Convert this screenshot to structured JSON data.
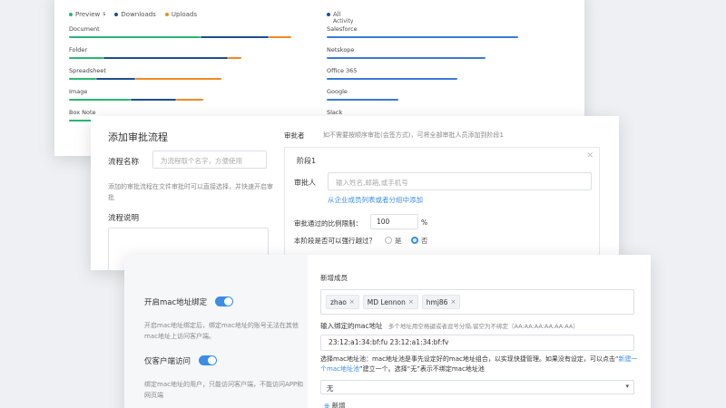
{
  "stats": {
    "legend": {
      "preview": "Preview",
      "preview_sub": "s",
      "downloads": "Downloads",
      "uploads": "Uploads"
    },
    "colors": {
      "preview": "#2bb673",
      "downloads": "#1f4e8c",
      "uploads": "#f08a24",
      "all": "#3a7bd5"
    },
    "left_rows": [
      {
        "label": "Document",
        "preview": 0.58,
        "downloads": 0.3,
        "uploads": 0.1
      },
      {
        "label": "Folder",
        "preview": 0.15,
        "downloads": 0.55,
        "uploads": 0.06
      },
      {
        "label": "Spreadsheet",
        "preview": 0.12,
        "downloads": 0.17,
        "uploads": 0.38
      },
      {
        "label": "Image",
        "preview": 0.27,
        "downloads": 0.2,
        "uploads": 0.12
      },
      {
        "label": "Box Note",
        "preview": 0.16,
        "downloads": 0.0,
        "uploads": 0.0
      }
    ],
    "right_legend": {
      "all": "All",
      "all_sub": "Activity"
    },
    "right_rows": [
      {
        "label": "Salesforce",
        "value": 0.88
      },
      {
        "label": "Netskope",
        "value": 0.73
      },
      {
        "label": "Office 365",
        "value": 0.6
      },
      {
        "label": "Google",
        "value": 0.33
      },
      {
        "label": "Slack",
        "value": 0.0
      }
    ]
  },
  "flow": {
    "title": "添加审批流程",
    "name_label": "流程名称",
    "name_placeholder": "为流程取个名字，方便使用",
    "name_hint": "添加的审批流程在文件审批时可以直接选择，并快速开启审批",
    "desc_label": "流程说明",
    "approver_label": "审批者",
    "approver_hint": "如不需要按顺序审批(会签方式)，可将全部审批人员添加到阶段1",
    "stage_title": "阶段1",
    "stage_approver_label": "审批人",
    "stage_approver_placeholder": "输入姓名,邮箱,或手机号",
    "add_from_group": "从企业成员列表或者分组中添加",
    "ratio_label": "审批通过的比例限制：",
    "ratio_value": "100",
    "ratio_unit": "%",
    "skip_label": "本阶段是否可以强行越过？",
    "skip_yes": "是",
    "skip_no": "否"
  },
  "mac": {
    "bind_label": "开启mac地址绑定",
    "bind_hint": "开启mac地址绑定后，绑定mac地址的账号无法在其他mac地址上访问客户端。",
    "client_only_label": "仅客户端访问",
    "client_only_hint": "绑定mac地址的用户，只能访问客户端，不能访问APP和网页端",
    "new_members_label": "新增成员",
    "members": [
      "zhao",
      "MD Lennon",
      "hmj86"
    ],
    "member_remove": "×",
    "mac_input_label": "输入绑定的mac地址",
    "mac_input_hint": "多个地址用空格键或者逗号分隔,留空为不绑定（AA:AA:AA:AA:AA:AA）",
    "mac_value": "23:12:a1:34:bf:fu  23:12:a1:34:bf:fv",
    "pool_text_1": "选择mac地址池：mac地址池是事先设定好的mac地址组合，以实现快捷管理。如果没有设定，可以点击“",
    "pool_link": "新建一个mac地址池",
    "pool_text_2": "”建立一个。选择“无”表示不绑定mac地址池",
    "pool_select": "无",
    "add_new": "新增"
  }
}
